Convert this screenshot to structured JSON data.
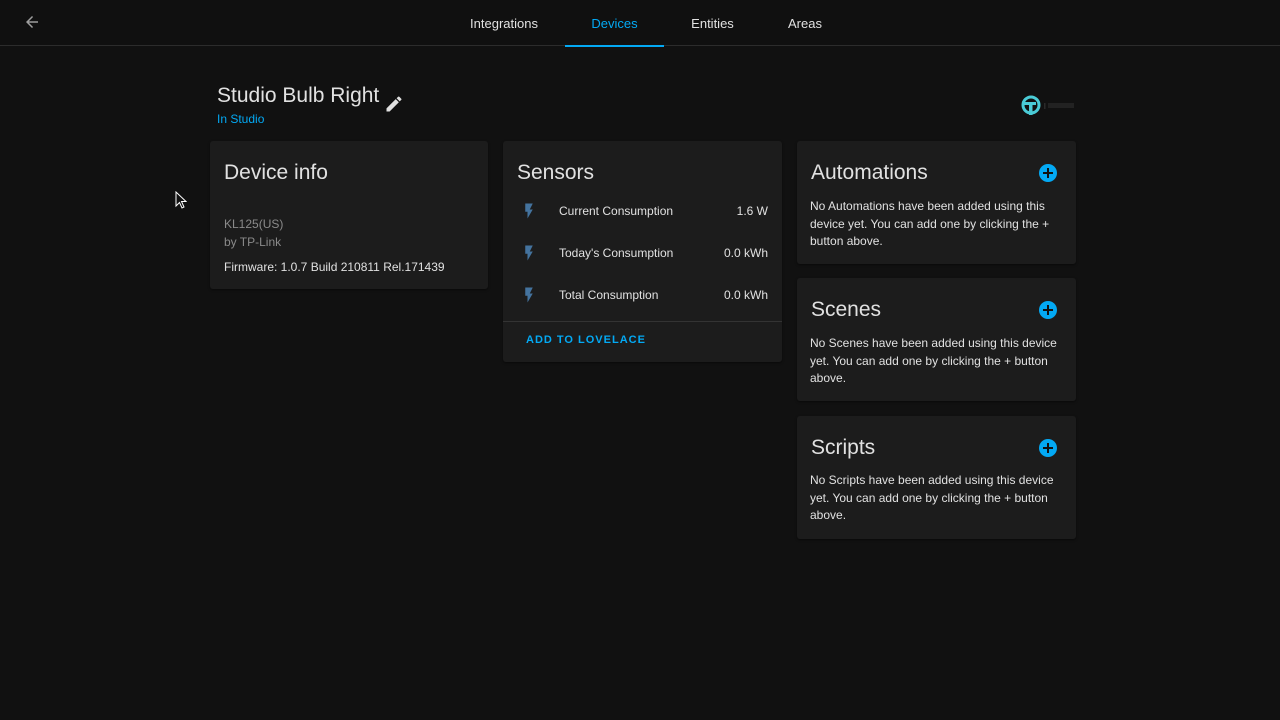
{
  "header": {
    "back_icon": "arrow-left-icon",
    "tabs": [
      {
        "label": "Integrations",
        "active": false
      },
      {
        "label": "Devices",
        "active": true
      },
      {
        "label": "Entities",
        "active": false
      },
      {
        "label": "Areas",
        "active": false
      }
    ]
  },
  "device": {
    "name": "Studio Bulb Right",
    "area": "In Studio",
    "edit_icon": "pencil-icon",
    "brand_logo": "tp-link-logo"
  },
  "device_info": {
    "title": "Device info",
    "model": "KL125(US)",
    "manufacturer": "by TP-Link",
    "firmware": "Firmware: 1.0.7 Build 210811 Rel.171439"
  },
  "sensors": {
    "title": "Sensors",
    "items": [
      {
        "icon": "flash-icon",
        "name": "Current Consumption",
        "value": "1.6 W"
      },
      {
        "icon": "flash-icon",
        "name": "Today's Consumption",
        "value": "0.0 kWh"
      },
      {
        "icon": "flash-icon",
        "name": "Total Consumption",
        "value": "0.0 kWh"
      }
    ],
    "action_label": "ADD TO LOVELACE"
  },
  "automations": {
    "title": "Automations",
    "empty_text": "No Automations have been added using this device yet. You can add one by clicking the + button above."
  },
  "scenes": {
    "title": "Scenes",
    "empty_text": "No Scenes have been added using this device yet. You can add one by clicking the + button above."
  },
  "scripts": {
    "title": "Scripts",
    "empty_text": "No Scripts have been added using this device yet. You can add one by clicking the + button above."
  },
  "colors": {
    "accent": "#03a9f4",
    "background": "#111111",
    "card": "#1c1c1c",
    "text": "#e1e1e1",
    "secondary_text": "#8a8a8a",
    "sensor_icon": "#44739e"
  }
}
